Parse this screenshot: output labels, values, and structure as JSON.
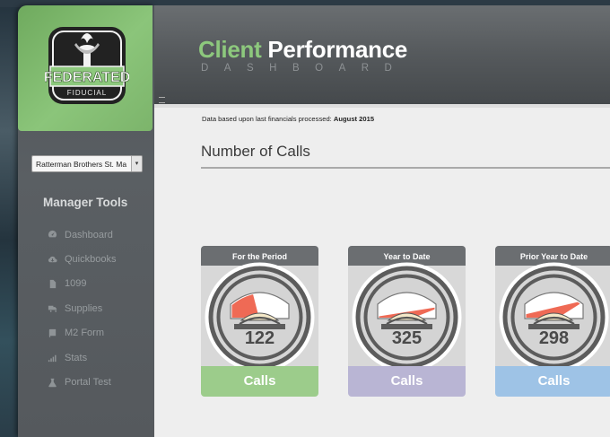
{
  "brand": {
    "name": "FEDERATED",
    "tagline": "FIDUCIAL",
    "color_green": "#8dc87d",
    "icon": "torch-logo-icon"
  },
  "header": {
    "title_part1": "Client",
    "title_part2": "Performance",
    "subtitle": "DASHBOARD"
  },
  "sidebar": {
    "client_select_value": "Ratterman Brothers St. Ma",
    "section_title": "Manager Tools",
    "items": [
      {
        "label": "Dashboard",
        "icon": "dashboard-icon"
      },
      {
        "label": "Quickbooks",
        "icon": "cloud-download-icon"
      },
      {
        "label": "1099",
        "icon": "document-icon"
      },
      {
        "label": "Supplies",
        "icon": "truck-icon"
      },
      {
        "label": "M2 Form",
        "icon": "book-icon"
      },
      {
        "label": "Stats",
        "icon": "signal-bars-icon"
      },
      {
        "label": "Portal Test",
        "icon": "flask-icon"
      }
    ]
  },
  "main": {
    "processed_prefix": "Data based upon last financials processed:",
    "processed_date": "August 2015",
    "section_title": "Number of Calls",
    "cards": [
      {
        "header": "For the Period",
        "value": "122",
        "unit": "Calls",
        "fill_fraction": 0.42,
        "color": "#9ccc8b"
      },
      {
        "header": "Year to Date",
        "value": "325",
        "unit": "Calls",
        "fill_fraction": 0.88,
        "color": "#b9b5d4"
      },
      {
        "header": "Prior Year to Date",
        "value": "298",
        "unit": "Calls",
        "fill_fraction": 0.82,
        "color": "#9ec3e6"
      }
    ]
  }
}
